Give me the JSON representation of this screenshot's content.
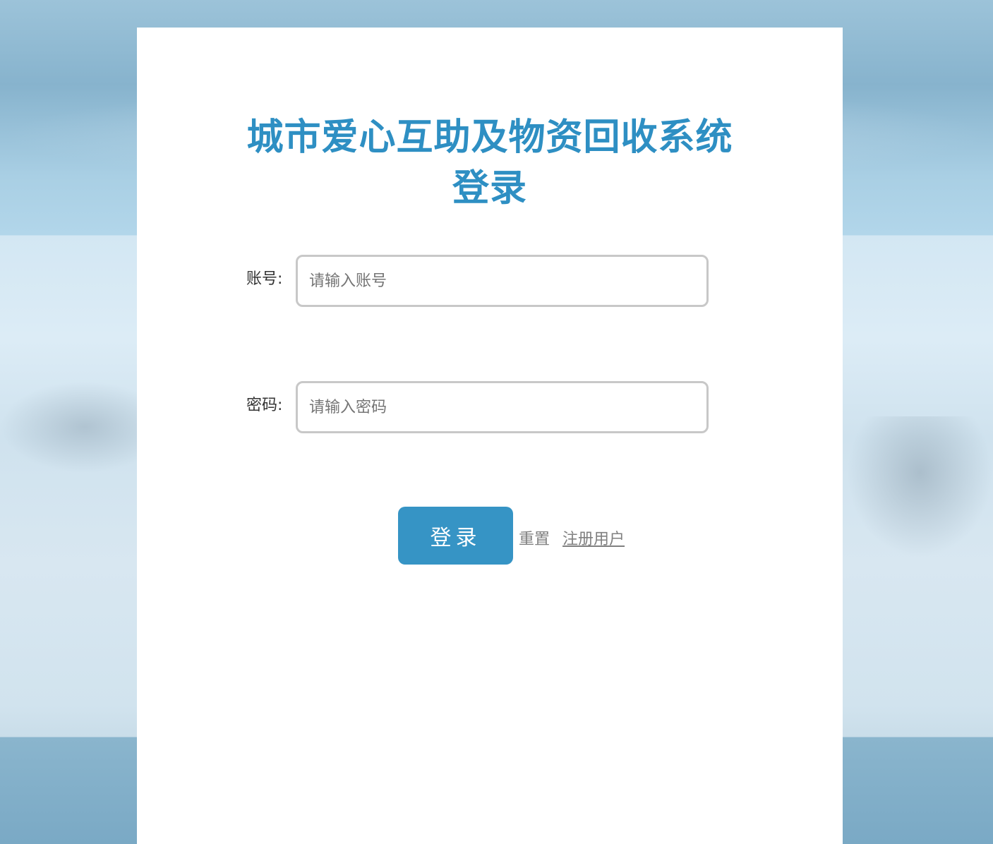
{
  "header": {
    "title_line1": "城市爱心互助及物资回收系统",
    "title_line2": "登录"
  },
  "form": {
    "account": {
      "label": "账号:",
      "value": "",
      "placeholder": "请输入账号"
    },
    "password": {
      "label": "密码:",
      "value": "",
      "placeholder": "请输入密码"
    }
  },
  "actions": {
    "login_label": "登录",
    "reset_label": "重置",
    "register_label": "注册用户"
  },
  "colors": {
    "accent": "#2e8fc3",
    "button": "#3694c5",
    "link": "#808080",
    "input_border": "#c8c8c8"
  }
}
